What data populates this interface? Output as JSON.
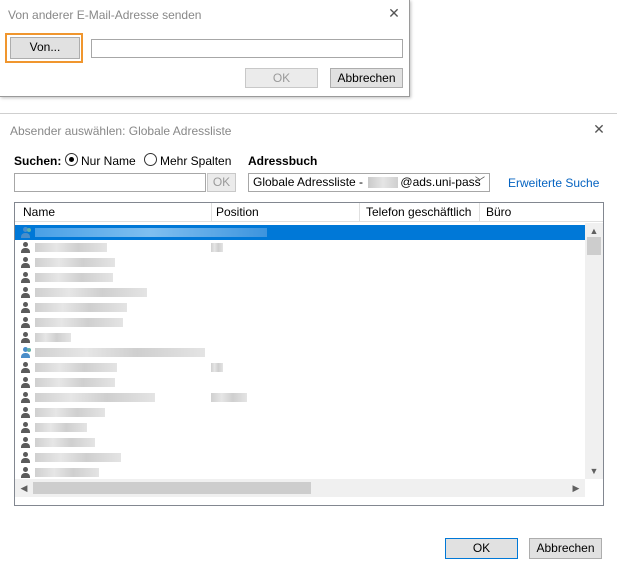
{
  "send_dialog": {
    "title": "Von anderer E-Mail-Adresse senden",
    "from_button": "Von...",
    "from_value": "",
    "ok": "OK",
    "cancel": "Abbrechen"
  },
  "select_dialog": {
    "title": "Absender auswählen: Globale Adressliste",
    "search_label": "Suchen:",
    "radio_name_only": "Nur Name",
    "radio_more_columns": "Mehr Spalten",
    "addressbook_label": "Adressbuch",
    "search_value": "",
    "search_ok": "OK",
    "addressbook_prefix": "Globale Adressliste - ",
    "addressbook_suffix": "@ads.uni-pass",
    "advanced_search": "Erweiterte Suche",
    "columns": [
      "Name",
      "Position",
      "Telefon geschäftlich",
      "Büro"
    ],
    "ok": "OK",
    "cancel": "Abbrechen"
  },
  "colors": {
    "accent": "#0078d7",
    "focus": "#f0962e",
    "link": "#0563c1"
  }
}
